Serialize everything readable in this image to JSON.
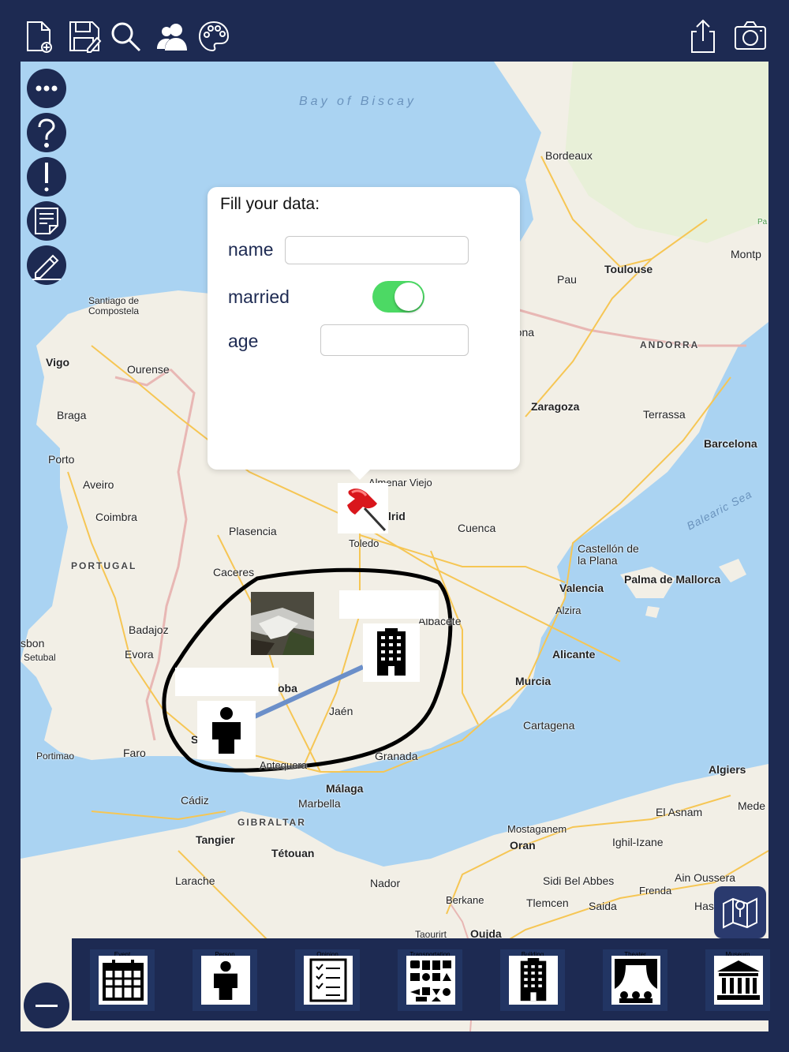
{
  "toolbar": {
    "left_icons": [
      "new-document-icon",
      "save-icon",
      "search-icon",
      "users-icon",
      "palette-icon"
    ],
    "right_icons": [
      "share-icon",
      "camera-icon"
    ]
  },
  "side_buttons": [
    "more-icon",
    "help-icon",
    "alert-icon",
    "notes-icon",
    "draw-icon"
  ],
  "popup": {
    "title": "Fill your data:",
    "fields": {
      "name_label": "name",
      "name_value": "",
      "married_label": "married",
      "married_on": true,
      "age_label": "age",
      "age_value": ""
    }
  },
  "map_labels": {
    "bay": "Bay of Biscay",
    "bordeaux": "Bordeaux",
    "toulouse": "Toulouse",
    "pau": "Pau",
    "montp": "Montp",
    "andorra": "ANDORRA",
    "pamplona": "Pamplona",
    "santiago": "Santiago de Compostela",
    "vigo": "Vigo",
    "ourense": "Ourense",
    "braga": "Braga",
    "porto": "Porto",
    "aveiro": "Aveiro",
    "coimbra": "Coimbra",
    "portugal": "PORTUGAL",
    "plasencia": "Plasencia",
    "caceres": "Caceres",
    "badajoz": "Badajoz",
    "evora": "Evora",
    "lisbon": "sbon",
    "setubal": "Setubal",
    "faro": "Faro",
    "portimao": "Portimao",
    "zaragoza": "Zaragoza",
    "terrassa": "Terrassa",
    "barcelona": "Barcelona",
    "balearic": "Balearic Sea",
    "almenar": "Almenar Viejo",
    "madrid": "lrid",
    "toledo": "Toledo",
    "cuenca": "Cuenca",
    "castellon": "Castellón de la Plana",
    "valencia": "Valencia",
    "palma": "Palma de Mallorca",
    "alzira": "Alzira",
    "albacete": "Albacete",
    "alicante": "Alicante",
    "murcia": "Murcia",
    "cartagena": "Cartagena",
    "cordoba": "oba",
    "jaen": "Jaén",
    "granada": "Granada",
    "antequera": "Antequera",
    "sevilla_s": "S",
    "malaga": "Málaga",
    "marbella": "Marbella",
    "cadiz": "Cádiz",
    "gibraltar": "GIBRALTAR",
    "tangier": "Tangier",
    "tetouan": "Tétouan",
    "larache": "Larache",
    "nador": "Nador",
    "berkane": "Berkane",
    "taourirt": "Taourirt",
    "oujda": "Oujda",
    "tlemcen": "Tlemcen",
    "saida": "Saida",
    "sidi": "Sidi Bel Abbes",
    "oran": "Oran",
    "mostaganem": "Mostaganem",
    "ighil": "Ighil-Izane",
    "elasnam": "El Asnam",
    "algiers": "Algiers",
    "medea": "Mede",
    "ainoussera": "Ain Oussera",
    "frenda": "Frenda",
    "hassi": "Hassi B",
    "pa_de": "Pa de"
  },
  "palette": [
    {
      "name": "Event",
      "icon": "calendar-icon"
    },
    {
      "name": "Person",
      "icon": "person-icon"
    },
    {
      "name": "Opinion",
      "icon": "checklist-icon"
    },
    {
      "name": "Transportation",
      "icon": "transportation-icon"
    },
    {
      "name": "Building",
      "icon": "building-icon"
    },
    {
      "name": "Theater",
      "icon": "theater-icon"
    },
    {
      "name": "Museum",
      "icon": "museum-icon"
    }
  ],
  "colors": {
    "navy": "#1d2a52",
    "sea": "#aad3f2",
    "land": "#f2efe6",
    "toggle_on": "#4cd964",
    "link_line": "#6b8fc9",
    "pin": "#d9161c"
  }
}
